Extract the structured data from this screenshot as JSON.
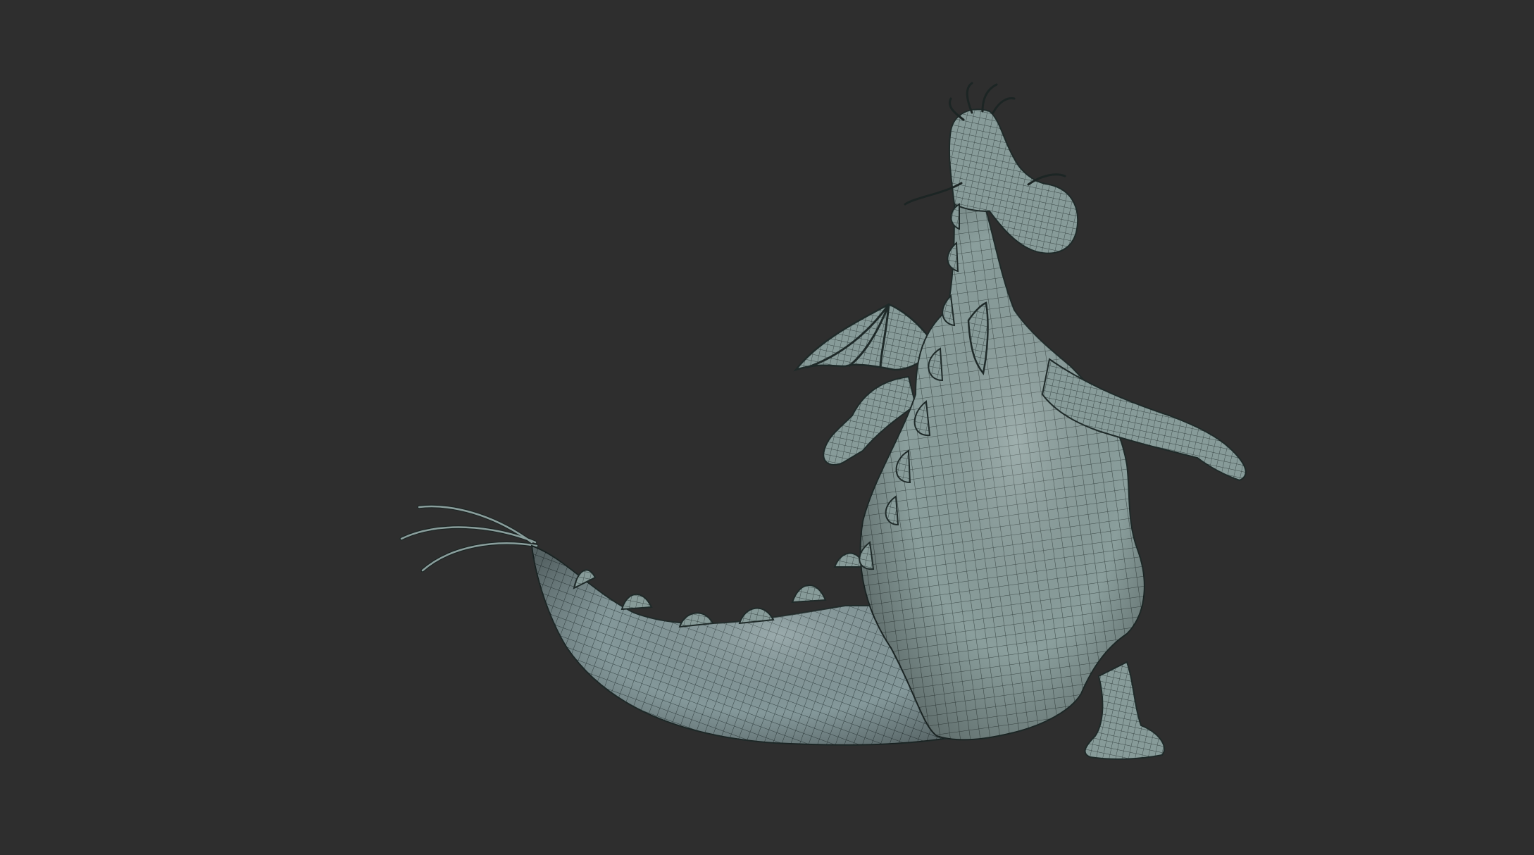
{
  "scene": {
    "subject": "dragon-wireframe-model",
    "background_color": "#2e2e2e",
    "mesh_color": "#8a9e9c",
    "wire_color": "#1f2a29",
    "highlight_color": "#a9bcba"
  }
}
